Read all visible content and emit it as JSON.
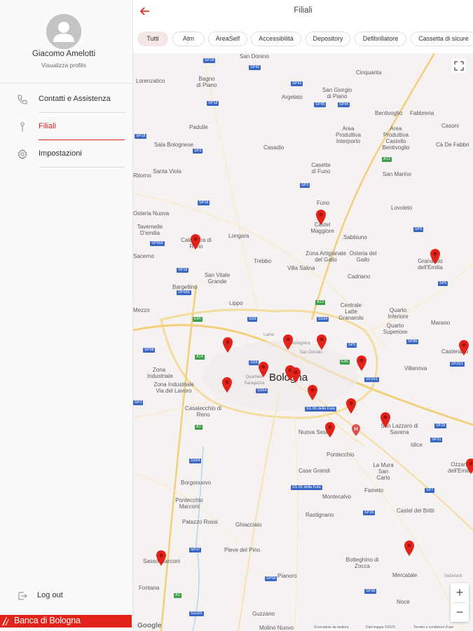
{
  "sidebar": {
    "user_name": "Giacomo Amelotti",
    "profile_link": "Visualizza profilo",
    "items": [
      {
        "label": "Contatti e Assistenza",
        "icon": "phone-icon"
      },
      {
        "label": "Filiali",
        "icon": "map-pin-icon",
        "active": true
      },
      {
        "label": "Impostazioni",
        "icon": "gear-icon"
      }
    ],
    "logout": "Log out",
    "brand": "Banca di Bologna"
  },
  "header": {
    "title": "Filiali",
    "back_icon": "arrow-left-icon"
  },
  "filters": [
    "Tutti",
    "Atm",
    "AreaSelf",
    "Accessibilità",
    "Depository",
    "Defibrillatore",
    "Cassetta di sicure"
  ],
  "colors": {
    "accent": "#e2231a",
    "active_chip_bg": "#f6e6e6",
    "map_bg": "#f6f2f2"
  },
  "map": {
    "city": "Bologna",
    "places": [
      "San Donino",
      "Cinquanta",
      "Lorenzatico",
      "Bagno di Piano",
      "Argelato",
      "San Giorgio di Piano",
      "Bentivoglio",
      "Fabbreria",
      "Casoni",
      "Padulle",
      "Area Produttiva Interporto",
      "Area Produttiva Castello Bentivoglio",
      "Cà De Fabbri",
      "Sala Bolognese",
      "Casadio",
      "Casette di Funo",
      "Santa Viola",
      "San Marino",
      "Funo",
      "Lovoleto",
      "Castel Maggiore",
      "Sabbiuno",
      "Granarolo dell'Emilia",
      "Longara",
      "Calderara di Reno",
      "Zona Artigianale del Gallo",
      "Osteria del Gallo",
      "Trebbo",
      "Villa Salina",
      "Cadriano",
      "San Vitale Grande",
      "Bargellino",
      "Lippo",
      "Centrale Latte Granarolo",
      "Quarto Inferiore",
      "Quarto Superiore",
      "Marano",
      "Castenaso",
      "Villanova",
      "Zona Industriale",
      "Zona Industriale Via del Lavoro",
      "Casalecchio di Reno",
      "San Lazzaro di Savena",
      "Idice",
      "Pontecchio",
      "Case Grandi",
      "La Mura San Carlo",
      "Ozzano dell'Emilia",
      "Borgonuovo",
      "Fameto",
      "Pontecchio Marconi",
      "Palazzo Rossi",
      "Ghiacciaio",
      "Rastignano",
      "Castel dei Britti",
      "Montecalvo",
      "Pieve del Pino",
      "Botteghino di Zocca",
      "Mercatale",
      "Sasso Marconi",
      "Pianoro",
      "Noce",
      "Fontana",
      "Guzzano",
      "Molino Nuovo",
      "Lame",
      "Bolognina",
      "San Donato",
      "Quartiere Saragozza",
      "Nuova Sesta",
      "Ritorno",
      "Sacerno",
      "Tavernelle D'emilia",
      "Mezzo",
      "Osteria Nuova",
      "Settefonti"
    ],
    "google_label": "Google",
    "attribution": [
      "Scorciatoie da tastiera",
      "Dati mappa ©2023",
      "Termini e condizioni d'uso"
    ]
  }
}
